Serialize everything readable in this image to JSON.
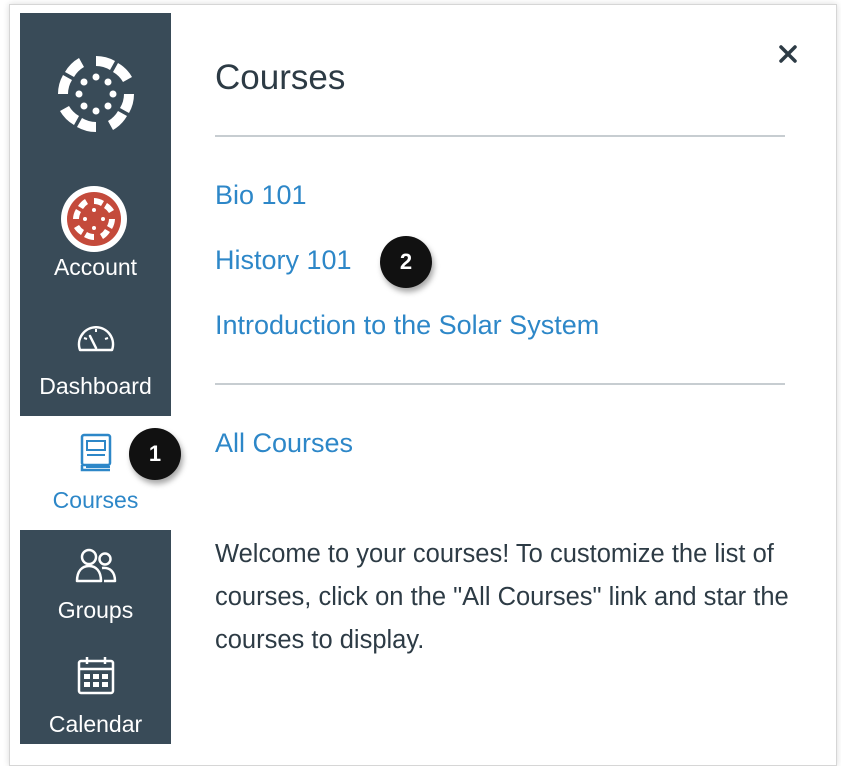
{
  "colors": {
    "nav_background": "#394b58",
    "link": "#2d87c8",
    "text": "#2d3b45",
    "active_nav": "#2d87c8",
    "account_avatar": "#c0392b",
    "badge": "#111111"
  },
  "global_nav": {
    "items": [
      {
        "label": "Account",
        "icon": "account-avatar-icon",
        "active": false
      },
      {
        "label": "Dashboard",
        "icon": "dashboard-gauge-icon",
        "active": false
      },
      {
        "label": "Courses",
        "icon": "courses-book-icon",
        "active": true
      },
      {
        "label": "Groups",
        "icon": "groups-people-icon",
        "active": false
      },
      {
        "label": "Calendar",
        "icon": "calendar-icon",
        "active": false
      }
    ]
  },
  "tray": {
    "title": "Courses",
    "close_icon": "close-icon",
    "courses": [
      {
        "label": "Bio 101"
      },
      {
        "label": "History 101"
      },
      {
        "label": "Introduction to the Solar System"
      }
    ],
    "all_courses_label": "All Courses",
    "welcome_text": "Welcome to your courses! To customize the list of courses, click on the \"All Courses\" link and star the courses to display."
  },
  "callouts": [
    {
      "number": "1"
    },
    {
      "number": "2"
    }
  ]
}
